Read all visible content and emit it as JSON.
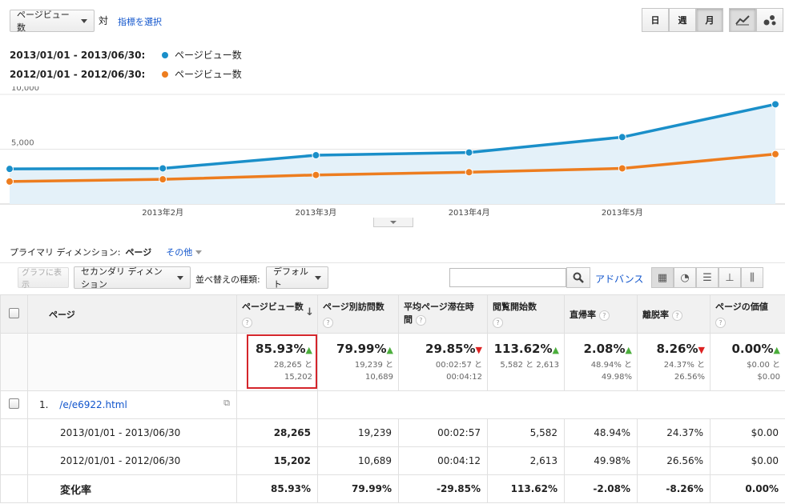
{
  "toolbar": {
    "metric_select": "ページビュー数",
    "vs_label": "対",
    "choose_metric_link": "指標を選択",
    "period_buttons": [
      "日",
      "週",
      "月"
    ],
    "active_period": "月"
  },
  "legend": [
    {
      "dates": "2013/01/01 - 2013/06/30:",
      "metric": "ページビュー数",
      "color": "#1a8fc9"
    },
    {
      "dates": "2012/01/01 - 2012/06/30:",
      "metric": "ページビュー数",
      "color": "#ed7d1f"
    }
  ],
  "chart_data": {
    "type": "line",
    "x": [
      "2013/01",
      "2013/02",
      "2013/03",
      "2013/04",
      "2013/05",
      "2013/06"
    ],
    "series": [
      {
        "values": [
          3200,
          3250,
          4450,
          4700,
          6100,
          9100
        ],
        "color": "#1a8fc9"
      },
      {
        "values": [
          2050,
          2250,
          2650,
          2900,
          3250,
          4550
        ],
        "color": "#ed7d1f"
      }
    ],
    "ylim": [
      0,
      10000
    ],
    "y_ticks": [
      "10,000",
      "5,000"
    ],
    "x_tick_labels": [
      "2013年2月",
      "2013年3月",
      "2013年4月",
      "2013年5月"
    ],
    "grid": true
  },
  "dimension_bar": {
    "primary_label": "プライマリ ディメンション:",
    "primary_value": "ページ",
    "other_link": "その他"
  },
  "controls": {
    "plot_rows": "グラフに表示",
    "secondary_dimension": "セカンダリ ディメンション",
    "sort_label": "並べ替えの種類:",
    "sort_value": "デフォルト",
    "search_value": "",
    "advanced_link": "アドバンス"
  },
  "table": {
    "headers": [
      "ページ",
      "ページビュー数",
      "ページ別訪問数",
      "平均ページ滞在時間",
      "閲覧開始数",
      "直帰率",
      "離脱率",
      "ページの価値"
    ],
    "summary": [
      {
        "big": "85.93%",
        "dir": "up",
        "a": "28,265 と",
        "b": "15,202"
      },
      {
        "big": "79.99%",
        "dir": "up",
        "a": "19,239 と",
        "b": "10,689"
      },
      {
        "big": "29.85%",
        "dir": "down",
        "a": "00:02:57 と",
        "b": "00:04:12"
      },
      {
        "big": "113.62%",
        "dir": "up",
        "a": "5,582 と 2,613",
        "b": ""
      },
      {
        "big": "2.08%",
        "dir": "up",
        "a": "48.94% と",
        "b": "49.98%"
      },
      {
        "big": "8.26%",
        "dir": "down",
        "a": "24.37% と",
        "b": "26.56%"
      },
      {
        "big": "0.00%",
        "dir": "up",
        "a": "$0.00 と",
        "b": "$0.00"
      }
    ],
    "row_index": "1.",
    "row_page": "/e/e6922.html",
    "rows": [
      {
        "label": "2013/01/01 - 2013/06/30",
        "values": [
          "28,265",
          "19,239",
          "00:02:57",
          "5,582",
          "48.94%",
          "24.37%",
          "$0.00"
        ]
      },
      {
        "label": "2012/01/01 - 2012/06/30",
        "values": [
          "15,202",
          "10,689",
          "00:04:12",
          "2,613",
          "49.98%",
          "26.56%",
          "$0.00"
        ]
      },
      {
        "label": "変化率",
        "values": [
          "85.93%",
          "79.99%",
          "-29.85%",
          "113.62%",
          "-2.08%",
          "-8.26%",
          "0.00%"
        ]
      }
    ]
  }
}
